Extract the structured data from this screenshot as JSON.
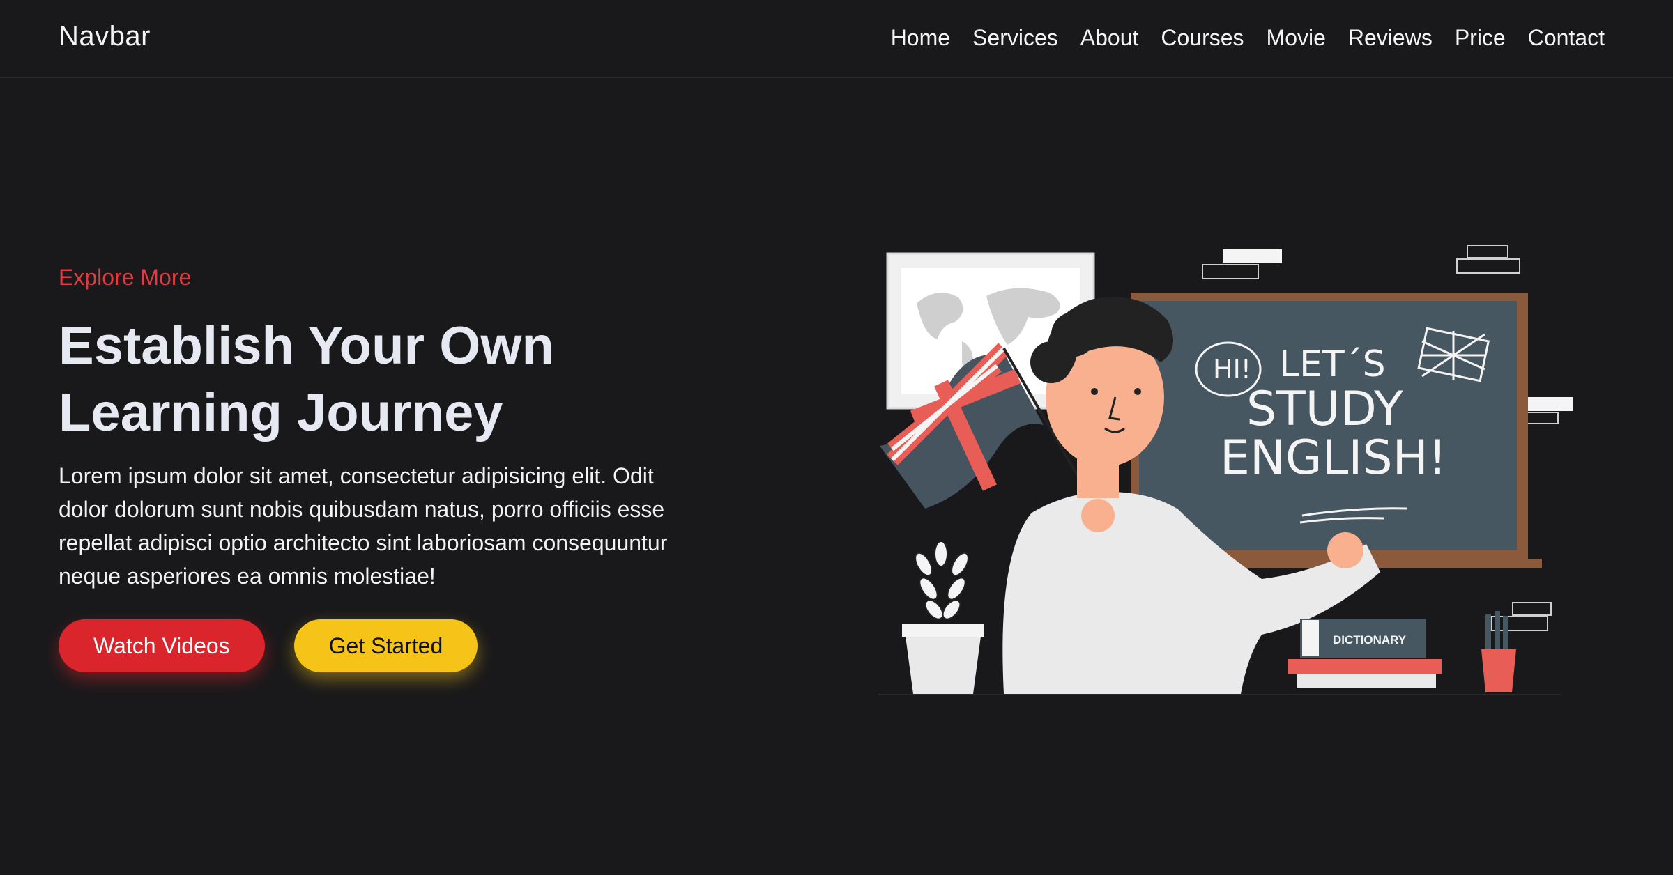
{
  "navbar": {
    "brand": "Navbar",
    "links": [
      "Home",
      "Services",
      "About",
      "Courses",
      "Movie",
      "Reviews",
      "Price",
      "Contact"
    ]
  },
  "hero": {
    "eyebrow": "Explore More",
    "title_line1": "Establish Your Own",
    "title_line2": "Learning Journey",
    "description": "Lorem ipsum dolor sit amet, consectetur adipisicing elit. Odit dolor dolorum sunt nobis quibusdam natus, porro officiis esse repellat adipisci optio architecto sint laboriosam consequuntur neque asperiores ea omnis molestiae!",
    "primary_button": "Watch Videos",
    "secondary_button": "Get Started"
  },
  "illustration": {
    "speech_bubble": "HI!",
    "board_line1": "LET´S",
    "board_line2": "STUDY",
    "board_line3": "ENGLISH!",
    "book_label": "DICTIONARY"
  },
  "colors": {
    "background": "#19191b",
    "accent_red": "#d9252b",
    "accent_yellow": "#f6c418",
    "eyebrow": "#e03b42"
  }
}
